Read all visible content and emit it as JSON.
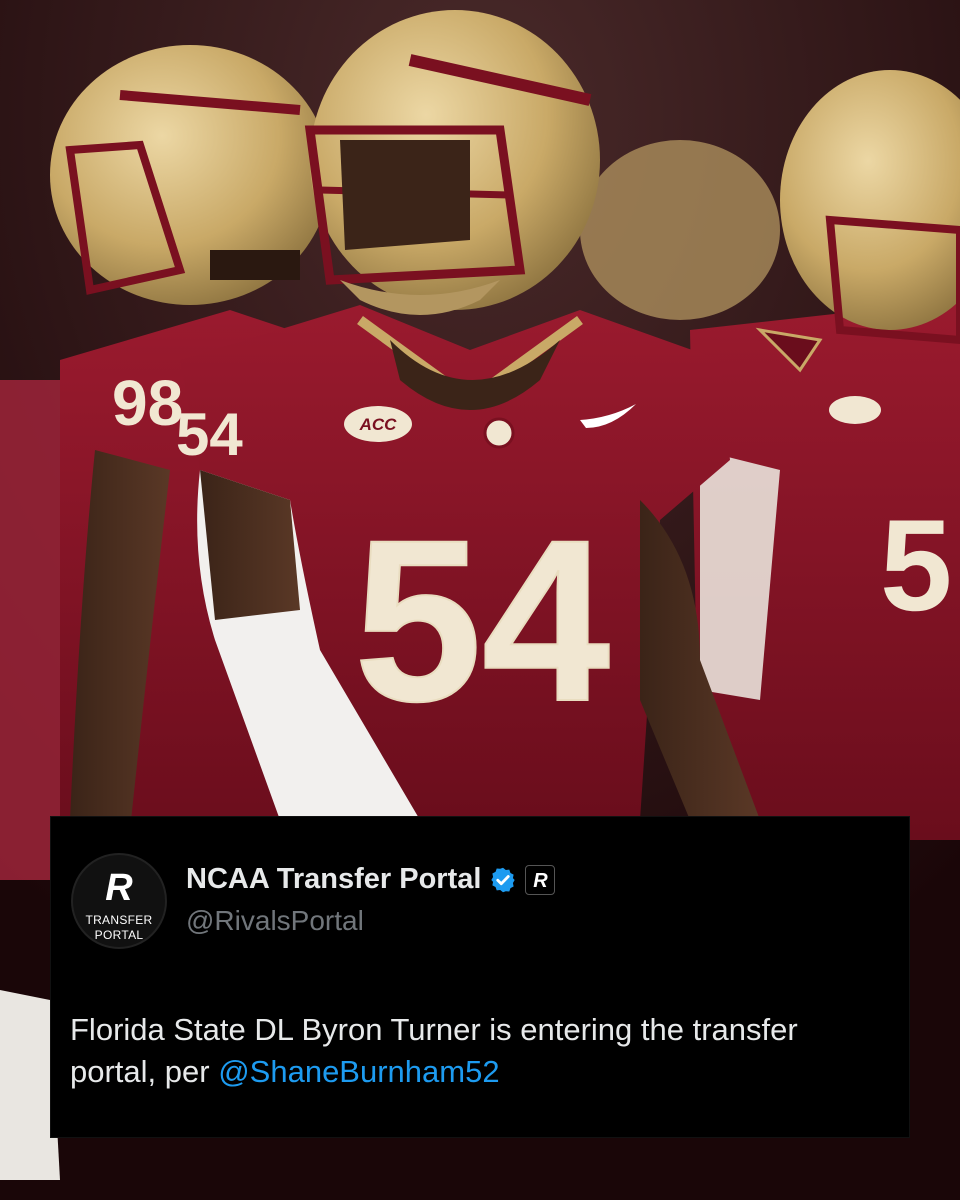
{
  "tweet": {
    "display_name": "NCAA Transfer Portal",
    "handle": "@RivalsPortal",
    "verified": true,
    "text_before": "Florida State DL Byron Turner is entering the transfer portal, per ",
    "mention": "@ShaneBurnham52",
    "avatar": {
      "logo_letter": "R",
      "line1": "TRANSFER",
      "line2": "PORTAL"
    },
    "badge_letter": "R"
  },
  "photo": {
    "jersey_numbers": [
      "54",
      "98",
      "54"
    ],
    "conference_patch": "ACC"
  },
  "colors": {
    "garnet": "#8a1428",
    "gold": "#c8a96a",
    "card_bg": "#000000",
    "link_blue": "#1d9bf0",
    "handle_gray": "#71767b",
    "verified_blue": "#1d9bf0"
  }
}
